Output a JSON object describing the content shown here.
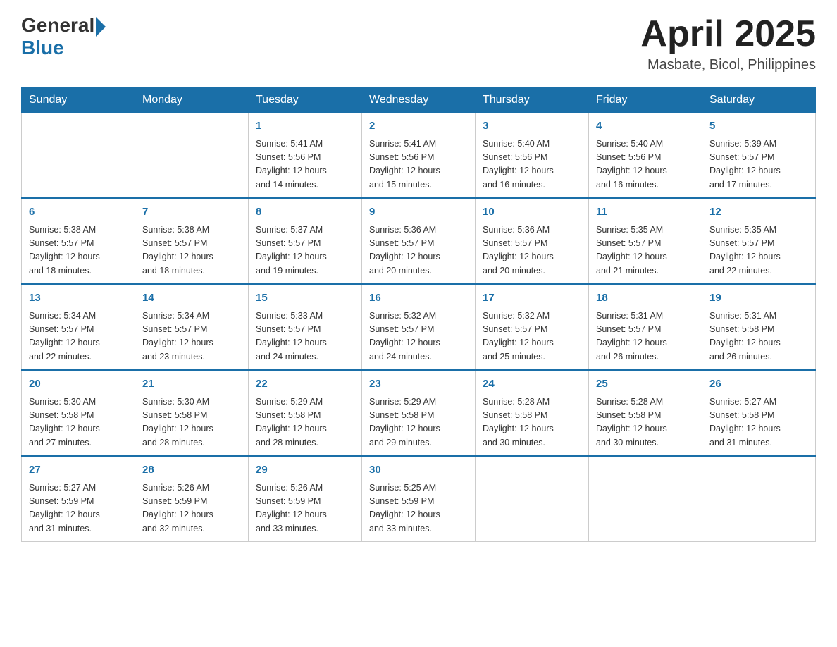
{
  "header": {
    "logo_general": "General",
    "logo_blue": "Blue",
    "month_title": "April 2025",
    "location": "Masbate, Bicol, Philippines"
  },
  "days_of_week": [
    "Sunday",
    "Monday",
    "Tuesday",
    "Wednesday",
    "Thursday",
    "Friday",
    "Saturday"
  ],
  "weeks": [
    [
      {
        "num": "",
        "info": ""
      },
      {
        "num": "",
        "info": ""
      },
      {
        "num": "1",
        "info": "Sunrise: 5:41 AM\nSunset: 5:56 PM\nDaylight: 12 hours\nand 14 minutes."
      },
      {
        "num": "2",
        "info": "Sunrise: 5:41 AM\nSunset: 5:56 PM\nDaylight: 12 hours\nand 15 minutes."
      },
      {
        "num": "3",
        "info": "Sunrise: 5:40 AM\nSunset: 5:56 PM\nDaylight: 12 hours\nand 16 minutes."
      },
      {
        "num": "4",
        "info": "Sunrise: 5:40 AM\nSunset: 5:56 PM\nDaylight: 12 hours\nand 16 minutes."
      },
      {
        "num": "5",
        "info": "Sunrise: 5:39 AM\nSunset: 5:57 PM\nDaylight: 12 hours\nand 17 minutes."
      }
    ],
    [
      {
        "num": "6",
        "info": "Sunrise: 5:38 AM\nSunset: 5:57 PM\nDaylight: 12 hours\nand 18 minutes."
      },
      {
        "num": "7",
        "info": "Sunrise: 5:38 AM\nSunset: 5:57 PM\nDaylight: 12 hours\nand 18 minutes."
      },
      {
        "num": "8",
        "info": "Sunrise: 5:37 AM\nSunset: 5:57 PM\nDaylight: 12 hours\nand 19 minutes."
      },
      {
        "num": "9",
        "info": "Sunrise: 5:36 AM\nSunset: 5:57 PM\nDaylight: 12 hours\nand 20 minutes."
      },
      {
        "num": "10",
        "info": "Sunrise: 5:36 AM\nSunset: 5:57 PM\nDaylight: 12 hours\nand 20 minutes."
      },
      {
        "num": "11",
        "info": "Sunrise: 5:35 AM\nSunset: 5:57 PM\nDaylight: 12 hours\nand 21 minutes."
      },
      {
        "num": "12",
        "info": "Sunrise: 5:35 AM\nSunset: 5:57 PM\nDaylight: 12 hours\nand 22 minutes."
      }
    ],
    [
      {
        "num": "13",
        "info": "Sunrise: 5:34 AM\nSunset: 5:57 PM\nDaylight: 12 hours\nand 22 minutes."
      },
      {
        "num": "14",
        "info": "Sunrise: 5:34 AM\nSunset: 5:57 PM\nDaylight: 12 hours\nand 23 minutes."
      },
      {
        "num": "15",
        "info": "Sunrise: 5:33 AM\nSunset: 5:57 PM\nDaylight: 12 hours\nand 24 minutes."
      },
      {
        "num": "16",
        "info": "Sunrise: 5:32 AM\nSunset: 5:57 PM\nDaylight: 12 hours\nand 24 minutes."
      },
      {
        "num": "17",
        "info": "Sunrise: 5:32 AM\nSunset: 5:57 PM\nDaylight: 12 hours\nand 25 minutes."
      },
      {
        "num": "18",
        "info": "Sunrise: 5:31 AM\nSunset: 5:57 PM\nDaylight: 12 hours\nand 26 minutes."
      },
      {
        "num": "19",
        "info": "Sunrise: 5:31 AM\nSunset: 5:58 PM\nDaylight: 12 hours\nand 26 minutes."
      }
    ],
    [
      {
        "num": "20",
        "info": "Sunrise: 5:30 AM\nSunset: 5:58 PM\nDaylight: 12 hours\nand 27 minutes."
      },
      {
        "num": "21",
        "info": "Sunrise: 5:30 AM\nSunset: 5:58 PM\nDaylight: 12 hours\nand 28 minutes."
      },
      {
        "num": "22",
        "info": "Sunrise: 5:29 AM\nSunset: 5:58 PM\nDaylight: 12 hours\nand 28 minutes."
      },
      {
        "num": "23",
        "info": "Sunrise: 5:29 AM\nSunset: 5:58 PM\nDaylight: 12 hours\nand 29 minutes."
      },
      {
        "num": "24",
        "info": "Sunrise: 5:28 AM\nSunset: 5:58 PM\nDaylight: 12 hours\nand 30 minutes."
      },
      {
        "num": "25",
        "info": "Sunrise: 5:28 AM\nSunset: 5:58 PM\nDaylight: 12 hours\nand 30 minutes."
      },
      {
        "num": "26",
        "info": "Sunrise: 5:27 AM\nSunset: 5:58 PM\nDaylight: 12 hours\nand 31 minutes."
      }
    ],
    [
      {
        "num": "27",
        "info": "Sunrise: 5:27 AM\nSunset: 5:59 PM\nDaylight: 12 hours\nand 31 minutes."
      },
      {
        "num": "28",
        "info": "Sunrise: 5:26 AM\nSunset: 5:59 PM\nDaylight: 12 hours\nand 32 minutes."
      },
      {
        "num": "29",
        "info": "Sunrise: 5:26 AM\nSunset: 5:59 PM\nDaylight: 12 hours\nand 33 minutes."
      },
      {
        "num": "30",
        "info": "Sunrise: 5:25 AM\nSunset: 5:59 PM\nDaylight: 12 hours\nand 33 minutes."
      },
      {
        "num": "",
        "info": ""
      },
      {
        "num": "",
        "info": ""
      },
      {
        "num": "",
        "info": ""
      }
    ]
  ]
}
